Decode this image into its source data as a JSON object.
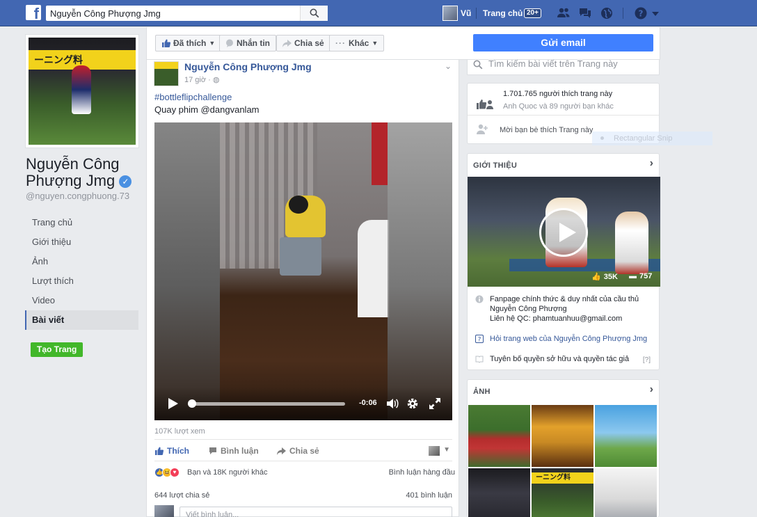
{
  "topbar": {
    "logo": "f",
    "search_value": "Nguyễn Công Phượng Jmg",
    "user_name": "Vũ",
    "home_label": "Trang chủ",
    "home_badge": "20+"
  },
  "page": {
    "name": "Nguyễn Công Phượng Jmg",
    "handle": "@nguyen.congphuong.73",
    "create_page": "Tạo Trang",
    "verified_glyph": "✓",
    "banner_text": "ーニング料"
  },
  "nav": [
    "Trang chủ",
    "Giới thiệu",
    "Ảnh",
    "Lượt thích",
    "Video",
    "Bài viết"
  ],
  "nav_active_index": 5,
  "action_bar": {
    "liked": "Đã thích",
    "message": "Nhắn tin",
    "share": "Chia sẻ",
    "more": "Khác",
    "email": "Gửi email"
  },
  "post": {
    "author": "Nguyễn Công Phượng Jmg",
    "time": "17 giờ",
    "hashtag": "#bottleflipchallenge",
    "text": "Quay phim @dangvanlam",
    "video_time": "-0:06",
    "progress": 0.01,
    "views": "107K lượt xem",
    "actions": {
      "like": "Thích",
      "comment": "Bình luận",
      "share": "Chia sẻ"
    },
    "reactions_text": "Bạn và 18K người khác",
    "comment_sort": "Bình luận hàng đầu",
    "shares": "644 lượt chia sẻ",
    "comments": "401 bình luận",
    "comment_placeholder": "Viết bình luận..."
  },
  "right": {
    "search_placeholder": "Tìm kiếm bài viết trên Trang này",
    "likes_count": "1.701.765 người thích trang này",
    "likes_friends": "Anh Quoc và 89 người bạn khác",
    "invite": "Mời bạn bè thích Trang này",
    "snip_label": "Rectangular Snip",
    "about_title": "GIỚI THIỆU",
    "about_video_likes": "35K",
    "about_video_comments": "757",
    "about_desc_line1": "Fanpage chính thức & duy nhất của cầu thủ",
    "about_desc_line2": "Nguyễn Công Phượng",
    "about_desc_line3": "Liên hệ QC: phamtuanhuu@gmail.com",
    "about_website": "Hỏi trang web của Nguyễn Công Phượng Jmg",
    "about_copyright": "Tuyên bố quyền sở hữu và quyền tác giả",
    "about_help": "[?]",
    "photos_title": "ẢNH",
    "photo_banner": "ーニング料"
  },
  "colors": {
    "brand": "#4267b2",
    "email_button": "#4080ff",
    "create_button": "#42b72a",
    "link": "#365899"
  }
}
